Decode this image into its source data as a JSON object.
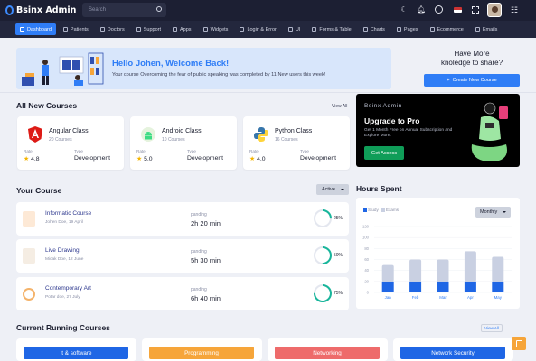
{
  "app": {
    "brand": "Bsinx Admin",
    "search_placeholder": "Search"
  },
  "nav": [
    {
      "label": "Dashboard",
      "active": true
    },
    {
      "label": "Patients"
    },
    {
      "label": "Doctors"
    },
    {
      "label": "Support"
    },
    {
      "label": "Apps"
    },
    {
      "label": "Widgets"
    },
    {
      "label": "Login & Error"
    },
    {
      "label": "UI"
    },
    {
      "label": "Forms & Table"
    },
    {
      "label": "Charts"
    },
    {
      "label": "Pages"
    },
    {
      "label": "Ecommerce"
    },
    {
      "label": "Emails"
    }
  ],
  "topbar_icons": [
    "moon-icon",
    "bell-icon",
    "chat-icon",
    "flag-icon",
    "fullscreen-icon",
    "settings-icon"
  ],
  "welcome": {
    "title": "Hello Johen, Welcome Back!",
    "subtitle": "Your course Overcoming the fear of public speaking was completed by 11 New users this week!"
  },
  "more": {
    "line1": "Have More",
    "line2": "knoledge to share?",
    "button": "Create New Course"
  },
  "all_new": {
    "title": "All New Courses",
    "view_all": "View All",
    "courses": [
      {
        "name": "Angular Class",
        "count": "20 Courses",
        "rate_label": "Rate",
        "rate": "4.8",
        "type_label": "Type",
        "type": "Development",
        "icon": "angular-icon"
      },
      {
        "name": "Android Class",
        "count": "10 Courses",
        "rate_label": "Rate",
        "rate": "5.0",
        "type_label": "Type",
        "type": "Development",
        "icon": "android-icon"
      },
      {
        "name": "Python Class",
        "count": "16 Courses",
        "rate_label": "Rate",
        "rate": "4.0",
        "type_label": "Type",
        "type": "Development",
        "icon": "python-icon"
      }
    ]
  },
  "promo": {
    "brand": "Bsinx Admin",
    "title": "Upgrade to Pro",
    "desc": "Get 1 Month Free on Annual Subscription and Explore More.",
    "button": "Get Access"
  },
  "your_course": {
    "title": "Your Course",
    "filter": "Active",
    "items": [
      {
        "name": "Informatic Course",
        "author": "Johen Doe, 19 April",
        "pending_label": "panding",
        "pending": "2h 20 min",
        "percent": 25,
        "percent_label": "25%"
      },
      {
        "name": "Live Drawing",
        "author": "Micak Doe, 12 June",
        "pending_label": "panding",
        "pending": "5h 30 min",
        "percent": 50,
        "percent_label": "50%"
      },
      {
        "name": "Contemporary Art",
        "author": "Potar doe, 27 July",
        "pending_label": "panding",
        "pending": "6h 40 min",
        "percent": 75,
        "percent_label": "75%"
      }
    ]
  },
  "hours": {
    "title": "Hours Spent",
    "filter": "Monthly",
    "colors": {
      "study": "#1f66e5",
      "exams": "#c9d0e2"
    }
  },
  "chart_data": {
    "type": "bar",
    "categories": [
      "Jan",
      "Feb",
      "Mar",
      "Apr",
      "May"
    ],
    "series": [
      {
        "name": "Study",
        "values": [
          20,
          20,
          20,
          20,
          20
        ]
      },
      {
        "name": "Exams",
        "values": [
          30,
          40,
          40,
          55,
          45
        ]
      }
    ],
    "stacked": true,
    "yticks": [
      "0",
      "20",
      "40",
      "60",
      "80",
      "100",
      "120"
    ],
    "ylim": [
      0,
      120
    ],
    "legend": "top-left",
    "grid": true
  },
  "running": {
    "title": "Current Running Courses",
    "view_all": "View All",
    "cards": [
      {
        "label": "It & software",
        "color": "#1f66e5"
      },
      {
        "label": "Programming",
        "color": "#f6a53a"
      },
      {
        "label": "Networking",
        "color": "#ee6b6b"
      },
      {
        "label": "Network Security",
        "color": "#1f66e5"
      }
    ]
  }
}
